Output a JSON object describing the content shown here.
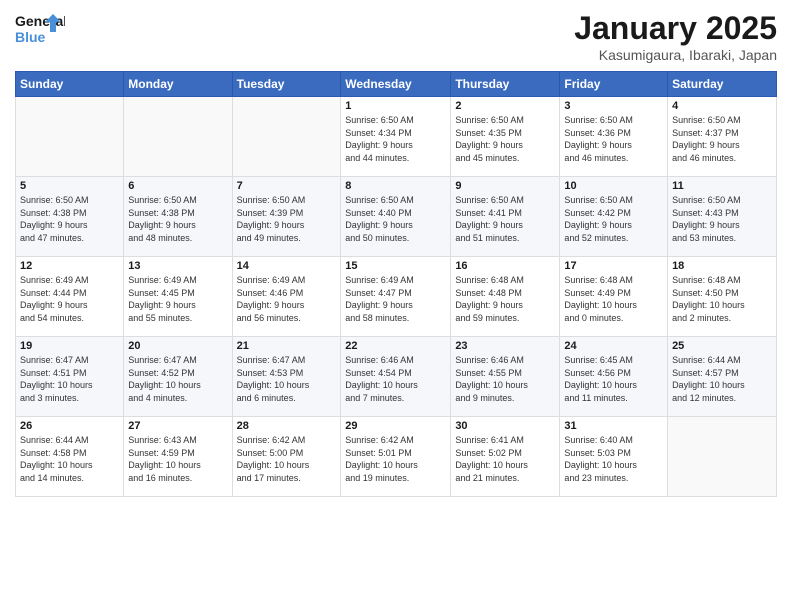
{
  "header": {
    "logo_line1": "General",
    "logo_line2": "Blue",
    "title": "January 2025",
    "subtitle": "Kasumigaura, Ibaraki, Japan"
  },
  "weekdays": [
    "Sunday",
    "Monday",
    "Tuesday",
    "Wednesday",
    "Thursday",
    "Friday",
    "Saturday"
  ],
  "weeks": [
    [
      {
        "day": "",
        "info": ""
      },
      {
        "day": "",
        "info": ""
      },
      {
        "day": "",
        "info": ""
      },
      {
        "day": "1",
        "info": "Sunrise: 6:50 AM\nSunset: 4:34 PM\nDaylight: 9 hours\nand 44 minutes."
      },
      {
        "day": "2",
        "info": "Sunrise: 6:50 AM\nSunset: 4:35 PM\nDaylight: 9 hours\nand 45 minutes."
      },
      {
        "day": "3",
        "info": "Sunrise: 6:50 AM\nSunset: 4:36 PM\nDaylight: 9 hours\nand 46 minutes."
      },
      {
        "day": "4",
        "info": "Sunrise: 6:50 AM\nSunset: 4:37 PM\nDaylight: 9 hours\nand 46 minutes."
      }
    ],
    [
      {
        "day": "5",
        "info": "Sunrise: 6:50 AM\nSunset: 4:38 PM\nDaylight: 9 hours\nand 47 minutes."
      },
      {
        "day": "6",
        "info": "Sunrise: 6:50 AM\nSunset: 4:38 PM\nDaylight: 9 hours\nand 48 minutes."
      },
      {
        "day": "7",
        "info": "Sunrise: 6:50 AM\nSunset: 4:39 PM\nDaylight: 9 hours\nand 49 minutes."
      },
      {
        "day": "8",
        "info": "Sunrise: 6:50 AM\nSunset: 4:40 PM\nDaylight: 9 hours\nand 50 minutes."
      },
      {
        "day": "9",
        "info": "Sunrise: 6:50 AM\nSunset: 4:41 PM\nDaylight: 9 hours\nand 51 minutes."
      },
      {
        "day": "10",
        "info": "Sunrise: 6:50 AM\nSunset: 4:42 PM\nDaylight: 9 hours\nand 52 minutes."
      },
      {
        "day": "11",
        "info": "Sunrise: 6:50 AM\nSunset: 4:43 PM\nDaylight: 9 hours\nand 53 minutes."
      }
    ],
    [
      {
        "day": "12",
        "info": "Sunrise: 6:49 AM\nSunset: 4:44 PM\nDaylight: 9 hours\nand 54 minutes."
      },
      {
        "day": "13",
        "info": "Sunrise: 6:49 AM\nSunset: 4:45 PM\nDaylight: 9 hours\nand 55 minutes."
      },
      {
        "day": "14",
        "info": "Sunrise: 6:49 AM\nSunset: 4:46 PM\nDaylight: 9 hours\nand 56 minutes."
      },
      {
        "day": "15",
        "info": "Sunrise: 6:49 AM\nSunset: 4:47 PM\nDaylight: 9 hours\nand 58 minutes."
      },
      {
        "day": "16",
        "info": "Sunrise: 6:48 AM\nSunset: 4:48 PM\nDaylight: 9 hours\nand 59 minutes."
      },
      {
        "day": "17",
        "info": "Sunrise: 6:48 AM\nSunset: 4:49 PM\nDaylight: 10 hours\nand 0 minutes."
      },
      {
        "day": "18",
        "info": "Sunrise: 6:48 AM\nSunset: 4:50 PM\nDaylight: 10 hours\nand 2 minutes."
      }
    ],
    [
      {
        "day": "19",
        "info": "Sunrise: 6:47 AM\nSunset: 4:51 PM\nDaylight: 10 hours\nand 3 minutes."
      },
      {
        "day": "20",
        "info": "Sunrise: 6:47 AM\nSunset: 4:52 PM\nDaylight: 10 hours\nand 4 minutes."
      },
      {
        "day": "21",
        "info": "Sunrise: 6:47 AM\nSunset: 4:53 PM\nDaylight: 10 hours\nand 6 minutes."
      },
      {
        "day": "22",
        "info": "Sunrise: 6:46 AM\nSunset: 4:54 PM\nDaylight: 10 hours\nand 7 minutes."
      },
      {
        "day": "23",
        "info": "Sunrise: 6:46 AM\nSunset: 4:55 PM\nDaylight: 10 hours\nand 9 minutes."
      },
      {
        "day": "24",
        "info": "Sunrise: 6:45 AM\nSunset: 4:56 PM\nDaylight: 10 hours\nand 11 minutes."
      },
      {
        "day": "25",
        "info": "Sunrise: 6:44 AM\nSunset: 4:57 PM\nDaylight: 10 hours\nand 12 minutes."
      }
    ],
    [
      {
        "day": "26",
        "info": "Sunrise: 6:44 AM\nSunset: 4:58 PM\nDaylight: 10 hours\nand 14 minutes."
      },
      {
        "day": "27",
        "info": "Sunrise: 6:43 AM\nSunset: 4:59 PM\nDaylight: 10 hours\nand 16 minutes."
      },
      {
        "day": "28",
        "info": "Sunrise: 6:42 AM\nSunset: 5:00 PM\nDaylight: 10 hours\nand 17 minutes."
      },
      {
        "day": "29",
        "info": "Sunrise: 6:42 AM\nSunset: 5:01 PM\nDaylight: 10 hours\nand 19 minutes."
      },
      {
        "day": "30",
        "info": "Sunrise: 6:41 AM\nSunset: 5:02 PM\nDaylight: 10 hours\nand 21 minutes."
      },
      {
        "day": "31",
        "info": "Sunrise: 6:40 AM\nSunset: 5:03 PM\nDaylight: 10 hours\nand 23 minutes."
      },
      {
        "day": "",
        "info": ""
      }
    ]
  ]
}
